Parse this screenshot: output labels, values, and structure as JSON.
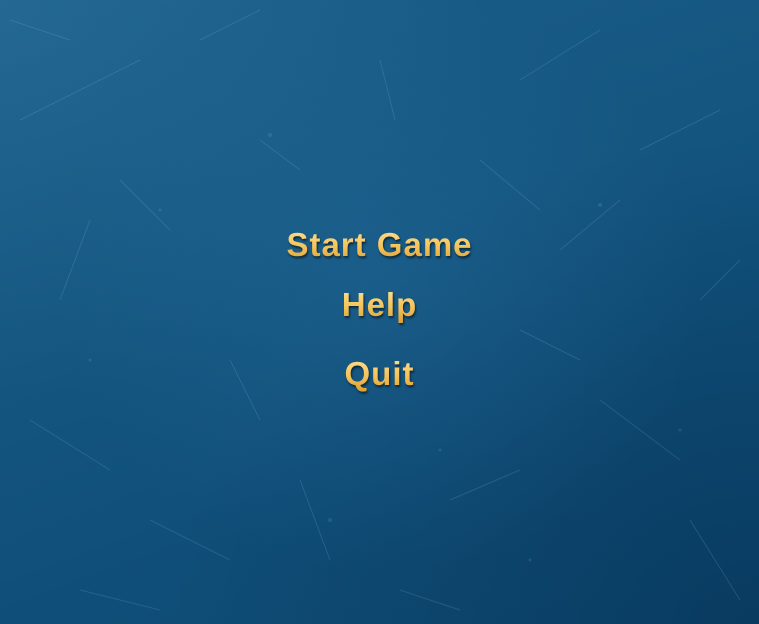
{
  "menu": {
    "items": [
      {
        "label": "Start Game"
      },
      {
        "label": "Help"
      },
      {
        "label": "Quit"
      }
    ]
  },
  "colors": {
    "background": "#145680",
    "menu_text": "#f2c766"
  }
}
